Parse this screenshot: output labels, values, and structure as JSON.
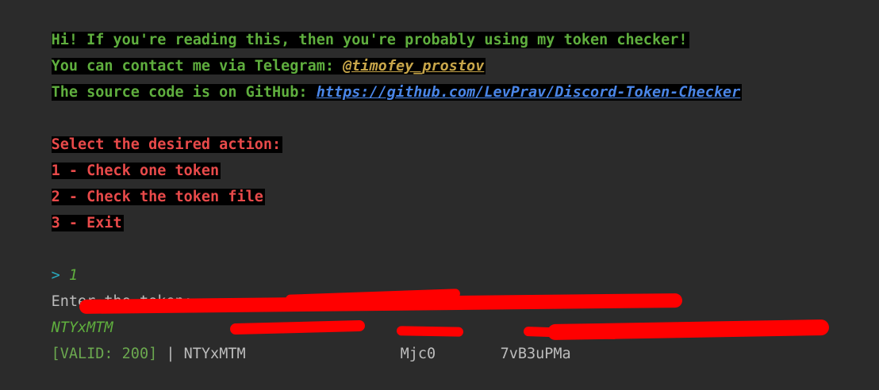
{
  "greeting": {
    "line1": "Hi! If you're reading this, then you're probably using my token checker!",
    "line2_prefix": "You can contact me via Telegram: ",
    "telegram_handle": "@timofey_prostov",
    "line3_prefix": "The source code is on GitHub: ",
    "github_url": "https://github.com/LevPrav/Discord-Token-Checker"
  },
  "menu": {
    "title": "Select the desired action:",
    "options": [
      "1 - Check one token",
      "2 - Check the token file",
      "3 - Exit"
    ]
  },
  "session": {
    "prompt_symbol": ">",
    "prompt_input": "1",
    "enter_label": "Enter the token:",
    "token_input_visible": "NTYxMTM",
    "result_status": "[VALID: 200]",
    "result_separator": " | ",
    "result_token_part1": "NTYxMTM",
    "result_token_part2": "Mjc0",
    "result_token_part3": "7vB3uPMa"
  },
  "colors": {
    "background": "#2b2b2b",
    "highlight": "#000000",
    "green_text": "#5fae3e",
    "red_text": "#e84a4a",
    "link": "#4a86e8",
    "redaction": "#ff0000"
  }
}
